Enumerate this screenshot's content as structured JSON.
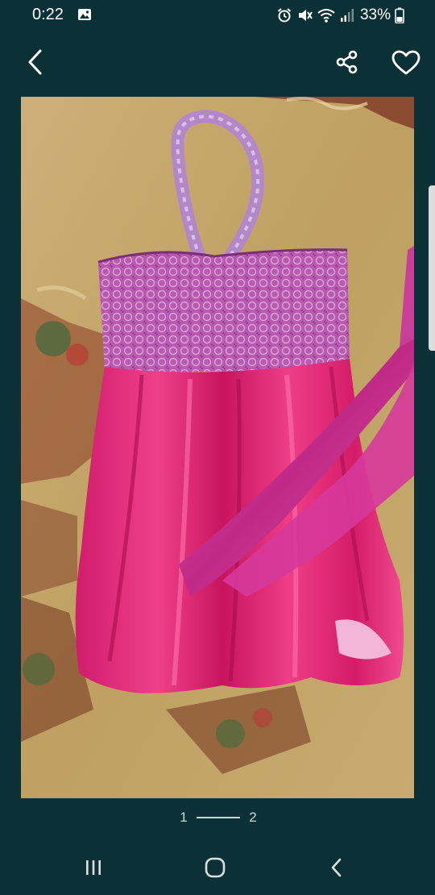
{
  "status_bar": {
    "time": "0:22",
    "battery_percent": "33%",
    "icons": [
      "gallery-icon",
      "alarm-icon",
      "mute-icon",
      "wifi-icon",
      "signal-icon",
      "battery-icon"
    ]
  },
  "app_bar": {
    "icons": [
      "chevron-left-icon",
      "share-icon",
      "heart-outline-icon"
    ]
  },
  "pager": {
    "current": "1",
    "total": "2"
  },
  "nav_bar": {
    "icons": [
      "recents-icon",
      "home-icon",
      "back-icon"
    ]
  },
  "colors": {
    "background": "#0b3136",
    "foreground": "#ffffff",
    "pager_text": "#cfd8d8"
  }
}
